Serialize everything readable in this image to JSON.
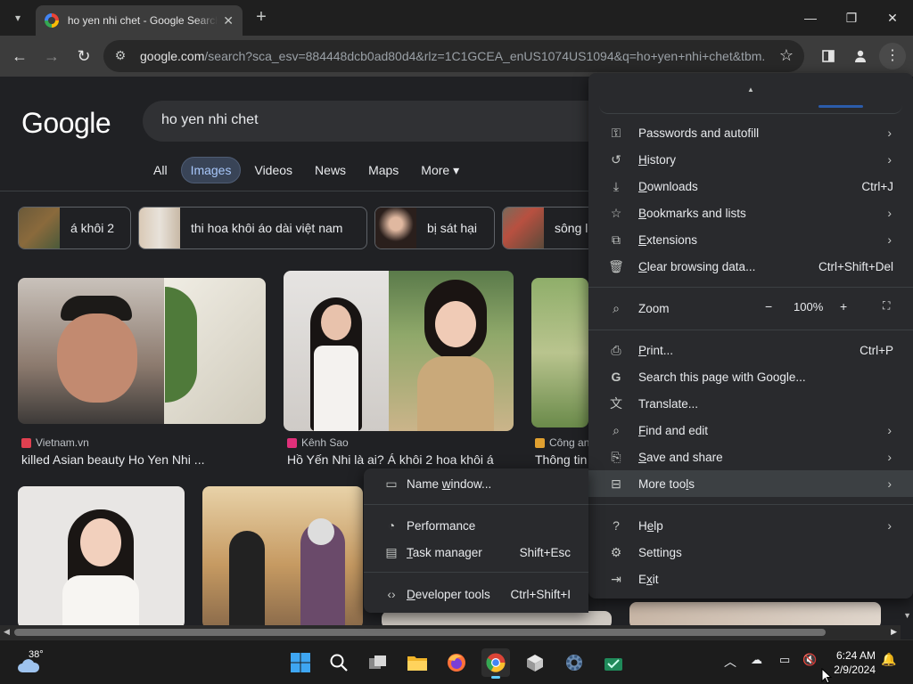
{
  "browser": {
    "tab_title": "ho yen nhi chet - Google Search",
    "url_domain": "google.com",
    "url_rest": "/search?sca_esv=884448dcb0ad80d4&rlz=1C1GCEA_enUS1074US1094&q=ho+yen+nhi+chet&tbm...",
    "icons": {
      "tab_list": "chevron-down-icon",
      "favicon": "google-favicon",
      "tab_close": "close-icon",
      "new_tab": "plus-icon",
      "minimize": "minimize-icon",
      "maximize": "restore-icon",
      "close_window": "close-icon",
      "back": "back-arrow-icon",
      "forward": "forward-arrow-icon",
      "reload": "reload-icon",
      "site_info": "tune-icon",
      "bookmark": "star-icon",
      "side_panel": "side-panel-icon",
      "profile": "profile-icon",
      "menu": "kebab-icon"
    }
  },
  "google": {
    "logo": "Google",
    "query": "ho yen nhi chet",
    "tabs": [
      "All",
      "Images",
      "Videos",
      "News",
      "Maps",
      "More ▾"
    ],
    "active_tab": "Images",
    "chips": [
      "á khôi 2",
      "thi hoa khôi áo dài việt nam",
      "bị sát hại",
      "sông l"
    ],
    "results": [
      {
        "source": "Vietnam.vn",
        "title": "killed Asian beauty Ho Yen Nhi ..."
      },
      {
        "source": "Kênh Sao",
        "title": "Hồ Yến Nhi là ai? Á khôi 2 hoa khôi á"
      },
      {
        "source": "Công an",
        "title": "Thông tin"
      }
    ]
  },
  "menu": {
    "items": [
      {
        "label": "Passwords and autofill",
        "underline": "",
        "shortcut": "",
        "submenu": true,
        "icon": "key-icon"
      },
      {
        "label": "History",
        "underline": "H",
        "shortcut": "",
        "submenu": true,
        "icon": "history-icon"
      },
      {
        "label": "Downloads",
        "underline": "D",
        "shortcut": "Ctrl+J",
        "submenu": false,
        "icon": "download-icon"
      },
      {
        "label": "Bookmarks and lists",
        "underline": "B",
        "shortcut": "",
        "submenu": true,
        "icon": "star-icon"
      },
      {
        "label": "Extensions",
        "underline": "E",
        "shortcut": "",
        "submenu": true,
        "icon": "puzzle-icon"
      },
      {
        "label": "Clear browsing data...",
        "underline": "C",
        "shortcut": "Ctrl+Shift+Del",
        "submenu": false,
        "icon": "trash-icon"
      }
    ],
    "zoom": {
      "label": "Zoom",
      "value": "100%",
      "minus": "−",
      "plus": "+"
    },
    "items2": [
      {
        "label": "Print...",
        "underline": "P",
        "shortcut": "Ctrl+P",
        "submenu": false,
        "icon": "print-icon"
      },
      {
        "label": "Search this page with Google...",
        "underline": "",
        "shortcut": "",
        "submenu": false,
        "icon": "google-g-icon"
      },
      {
        "label": "Translate...",
        "underline": "",
        "shortcut": "",
        "submenu": false,
        "icon": "translate-icon"
      },
      {
        "label": "Find and edit",
        "underline": "F",
        "shortcut": "",
        "submenu": true,
        "icon": "find-icon"
      },
      {
        "label": "Save and share",
        "underline": "S",
        "shortcut": "",
        "submenu": true,
        "icon": "save-share-icon"
      },
      {
        "label": "More tools",
        "underline": "L",
        "shortcut": "",
        "submenu": true,
        "icon": "toolbox-icon",
        "highlighted": true
      }
    ],
    "items3": [
      {
        "label": "Help",
        "underline": "e",
        "shortcut": "",
        "submenu": true,
        "icon": "help-icon"
      },
      {
        "label": "Settings",
        "underline": "g",
        "shortcut": "",
        "submenu": false,
        "icon": "gear-icon"
      },
      {
        "label": "Exit",
        "underline": "x",
        "shortcut": "",
        "submenu": false,
        "icon": "exit-icon"
      }
    ]
  },
  "submenu": {
    "items": [
      {
        "label": "Name window...",
        "underline": "w",
        "shortcut": "",
        "icon": "window-icon"
      },
      {
        "label": "Performance",
        "underline": "",
        "shortcut": "",
        "icon": "performance-icon"
      },
      {
        "label": "Task manager",
        "underline": "T",
        "shortcut": "Shift+Esc",
        "icon": "task-manager-icon"
      },
      {
        "label": "Developer tools",
        "underline": "D",
        "shortcut": "Ctrl+Shift+I",
        "icon": "code-icon"
      }
    ]
  },
  "taskbar": {
    "weather": "38°",
    "time": "6:24 AM",
    "date": "2/9/2024",
    "apps": [
      "start-icon",
      "search-icon",
      "task-view-icon",
      "file-explorer-icon",
      "firefox-icon",
      "chrome-icon",
      "package-icon",
      "settings-icon",
      "store-icon"
    ]
  }
}
